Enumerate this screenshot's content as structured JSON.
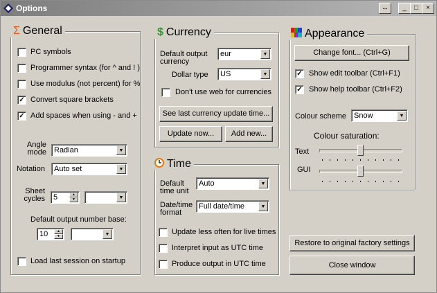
{
  "window": {
    "title": "Options",
    "controls": [
      "↔",
      "_",
      "□",
      "×"
    ]
  },
  "general": {
    "title": "General",
    "checkboxes": [
      {
        "label": "PC symbols",
        "checked": false
      },
      {
        "label": "Programmer syntax (for ^ and ! )",
        "checked": false
      },
      {
        "label": "Use modulus (not percent) for %",
        "checked": false
      },
      {
        "label": "Convert square brackets",
        "checked": true
      },
      {
        "label": "Add spaces when using - and +",
        "checked": true
      }
    ],
    "angle_label": "Angle mode",
    "angle_value": "Radian",
    "notation_label": "Notation",
    "notation_value": "Auto set",
    "sheet_label": "Sheet cycles",
    "sheet_value": "5",
    "sheet_combo": "",
    "base_label": "Default output number base:",
    "base_value": "10",
    "base_combo": "",
    "load_label": "Load last session on startup",
    "load_checked": false
  },
  "currency": {
    "title": "Currency",
    "default_label": "Default output currency",
    "default_value": "eur",
    "dollar_label": "Dollar type",
    "dollar_value": "US",
    "noweb_label": "Don't use web for currencies",
    "noweb_checked": false,
    "see_last_button": "See last currency update time...",
    "update_button": "Update now...",
    "add_button": "Add new..."
  },
  "time": {
    "title": "Time",
    "unit_label": "Default time unit",
    "unit_value": "Auto",
    "format_label": "Date/time format",
    "format_value": "Full date/time",
    "checkboxes": [
      {
        "label": "Update less often for live times",
        "checked": false
      },
      {
        "label": "Interpret input as UTC time",
        "checked": false
      },
      {
        "label": "Produce output in UTC time",
        "checked": false
      }
    ]
  },
  "appearance": {
    "title": "Appearance",
    "font_button": "Change font... (Ctrl+G)",
    "edit_toolbar": {
      "label": "Show edit toolbar (Ctrl+F1)",
      "checked": true
    },
    "help_toolbar": {
      "label": "Show help toolbar (Ctrl+F2)",
      "checked": true
    },
    "scheme_label": "Colour scheme",
    "scheme_value": "Snow",
    "saturation_label": "Colour saturation:",
    "text_label": "Text",
    "gui_label": "GUI",
    "text_level": 0.5,
    "gui_level": 0.5
  },
  "actions": {
    "restore_button": "Restore to original factory settings",
    "close_button": "Close window"
  },
  "icons": {
    "general": "sigma-icon",
    "currency": "dollar-icon",
    "time": "clock-icon",
    "appearance": "palette-icon"
  },
  "colors": {
    "sigma": "#e25a1c",
    "dollar": "#2e9b2e",
    "title_bar": "#7d7d7d"
  }
}
